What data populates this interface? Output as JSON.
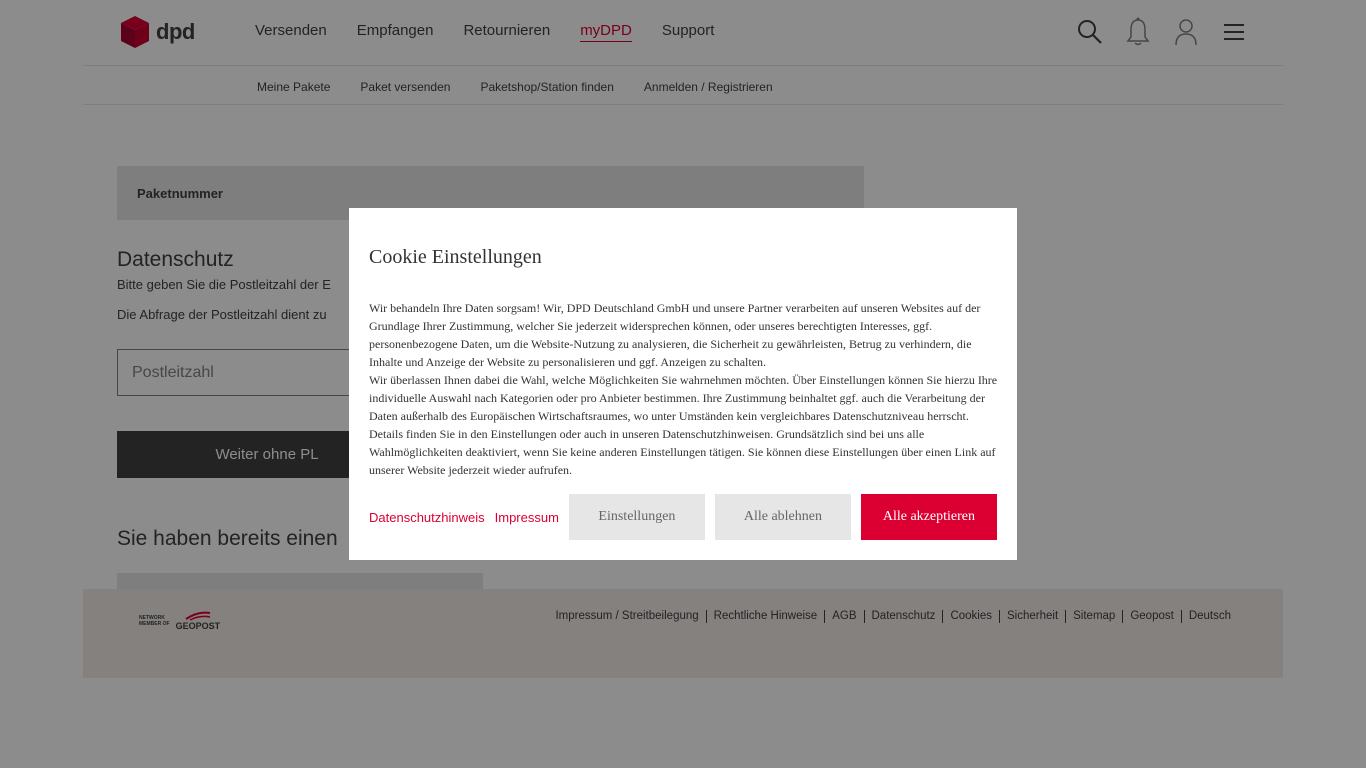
{
  "header": {
    "logo_text": "dpd",
    "nav": [
      "Versenden",
      "Empfangen",
      "Retournieren",
      "myDPD",
      "Support"
    ],
    "active_nav": "myDPD",
    "subnav": [
      "Meine Pakete",
      "Paket versenden",
      "Paketshop/Station finden",
      "Anmelden / Registrieren"
    ]
  },
  "main": {
    "parcel_label": "Paketnummer",
    "privacy_title": "Datenschutz",
    "privacy_text1": "Bitte geben Sie die Postleitzahl der E",
    "privacy_text2": "Die Abfrage der Postleitzahl dient zu",
    "plz_placeholder": "Postleitzahl",
    "continue_button": "Weiter ohne PL",
    "already_title": "Sie haben bereits einen"
  },
  "footer": {
    "network_line1": "NETWORK",
    "network_line2": "MEMBER OF",
    "geopost": "GEOPOST",
    "links": [
      "Impressum / Streitbeilegung",
      "Rechtliche Hinweise",
      "AGB",
      "Datenschutz",
      "Cookies",
      "Sicherheit",
      "Sitemap",
      "Geopost",
      "Deutsch"
    ]
  },
  "dialog": {
    "title": "Cookie Einstellungen",
    "paragraph1": "Wir behandeln Ihre Daten sorgsam! Wir, DPD Deutschland GmbH und unsere Partner verarbeiten auf unseren Websites auf der Grundlage Ihrer Zustimmung, welcher Sie jederzeit widersprechen können, oder unseres berechtigten Interesses, ggf. personenbezogene Daten, um die Website-Nutzung zu analysieren, die Sicherheit zu gewährleisten, Betrug zu verhindern, die Inhalte und Anzeige der Website zu personalisieren und ggf. Anzeigen zu schalten.",
    "paragraph2": "Wir überlassen Ihnen dabei die Wahl, welche Möglichkeiten Sie wahrnehmen möchten. Über Einstellungen können Sie hierzu Ihre individuelle Auswahl nach Kategorien oder pro Anbieter bestimmen. Ihre Zustimmung beinhaltet ggf. auch die Verarbeitung der Daten außerhalb des Europäischen Wirtschaftsraumes, wo unter Umständen kein vergleichbares Datenschutzniveau herrscht.",
    "paragraph3": "Details finden Sie in den Einstellungen oder auch in unseren Datenschutzhinweisen. Grundsätzlich sind bei uns alle Wahlmöglichkeiten deaktiviert, wenn Sie keine anderen Einstellungen tätigen. Sie können diese Einstellungen über einen Link auf unserer Website jederzeit wieder aufrufen.",
    "link_privacy": "Datenschutzhinweis",
    "link_imprint": "Impressum",
    "btn_settings": "Einstellungen",
    "btn_reject": "Alle ablehnen",
    "btn_accept": "Alle akzeptieren"
  },
  "colors": {
    "brand_red": "#dc0032",
    "text_dark": "#414042"
  }
}
